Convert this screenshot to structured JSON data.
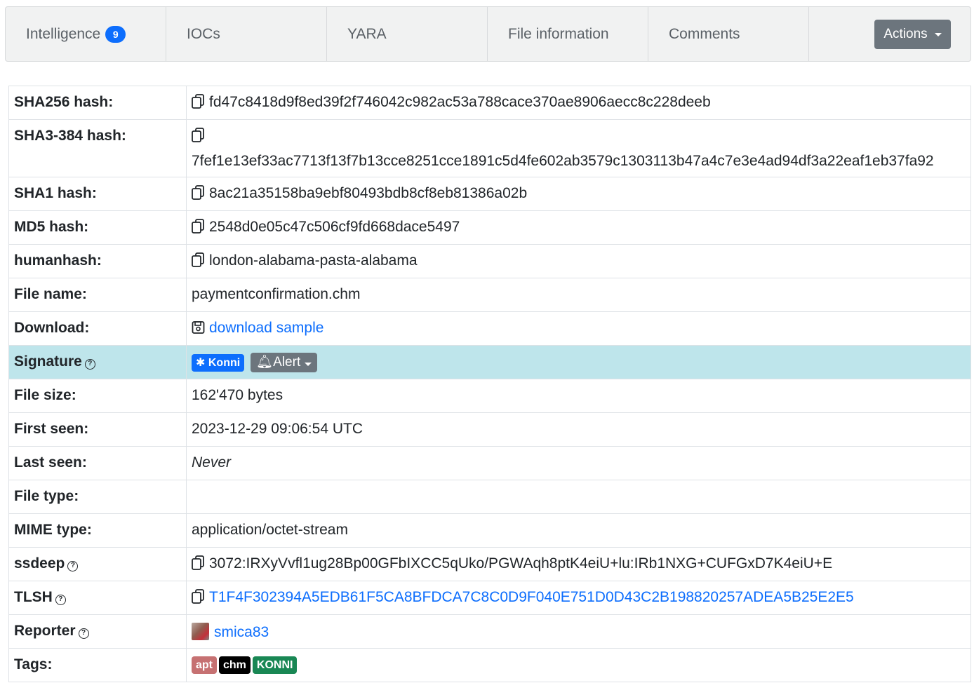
{
  "tabs": [
    {
      "label": "Intelligence",
      "count": "9"
    },
    {
      "label": "IOCs"
    },
    {
      "label": "YARA"
    },
    {
      "label": "File information"
    },
    {
      "label": "Comments"
    }
  ],
  "actions_label": "Actions",
  "rows": {
    "sha256": {
      "label": "SHA256 hash:",
      "value": "fd47c8418d9f8ed39f2f746042c982ac53a788cace370ae8906aecc8c228deeb"
    },
    "sha3": {
      "label": "SHA3-384 hash:",
      "value": "7fef1e13ef33ac7713f13f7b13cce8251cce1891c5d4fe602ab3579c1303113b47a4c7e3e4ad94df3a22eaf1eb37fa92"
    },
    "sha1": {
      "label": "SHA1 hash:",
      "value": "8ac21a35158ba9ebf80493bdb8cf8eb81386a02b"
    },
    "md5": {
      "label": "MD5 hash:",
      "value": "2548d0e05c47c506cf9fd668dace5497"
    },
    "humanhash": {
      "label": "humanhash:",
      "value": "london-alabama-pasta-alabama"
    },
    "filename": {
      "label": "File name:",
      "value": "paymentconfirmation.chm"
    },
    "download": {
      "label": "Download:",
      "value": "download sample"
    },
    "signature": {
      "label": "Signature",
      "badge": "Konni",
      "alert": "Alert"
    },
    "filesize": {
      "label": "File size:",
      "value": "162'470 bytes"
    },
    "firstseen": {
      "label": "First seen:",
      "value": "2023-12-29 09:06:54 UTC"
    },
    "lastseen": {
      "label": "Last seen:",
      "value": "Never"
    },
    "filetype": {
      "label": "File type:",
      "value": ""
    },
    "mime": {
      "label": "MIME type:",
      "value": "application/octet-stream"
    },
    "ssdeep": {
      "label": "ssdeep",
      "value": "3072:IRXyVvfl1ug28Bp00GFbIXCC5qUko/PGWAqh8ptK4eiU+lu:IRb1NXG+CUFGxD7K4eiU+E"
    },
    "tlsh": {
      "label": "TLSH",
      "value": "T1F4F302394A5EDB61F5CA8BFDCA7C8C0D9F040E751D0D43C2B198820257ADEA5B25E2E5"
    },
    "reporter": {
      "label": "Reporter",
      "value": "smica83"
    },
    "tags": {
      "label": "Tags:",
      "items": [
        "apt",
        "chm",
        "KONNI"
      ]
    }
  },
  "colors": {
    "accent": "#0d6efd",
    "signature_row": "#bee5eb",
    "tag_apt": "#c67172",
    "tag_chm": "#000000",
    "tag_konni": "#198754"
  }
}
